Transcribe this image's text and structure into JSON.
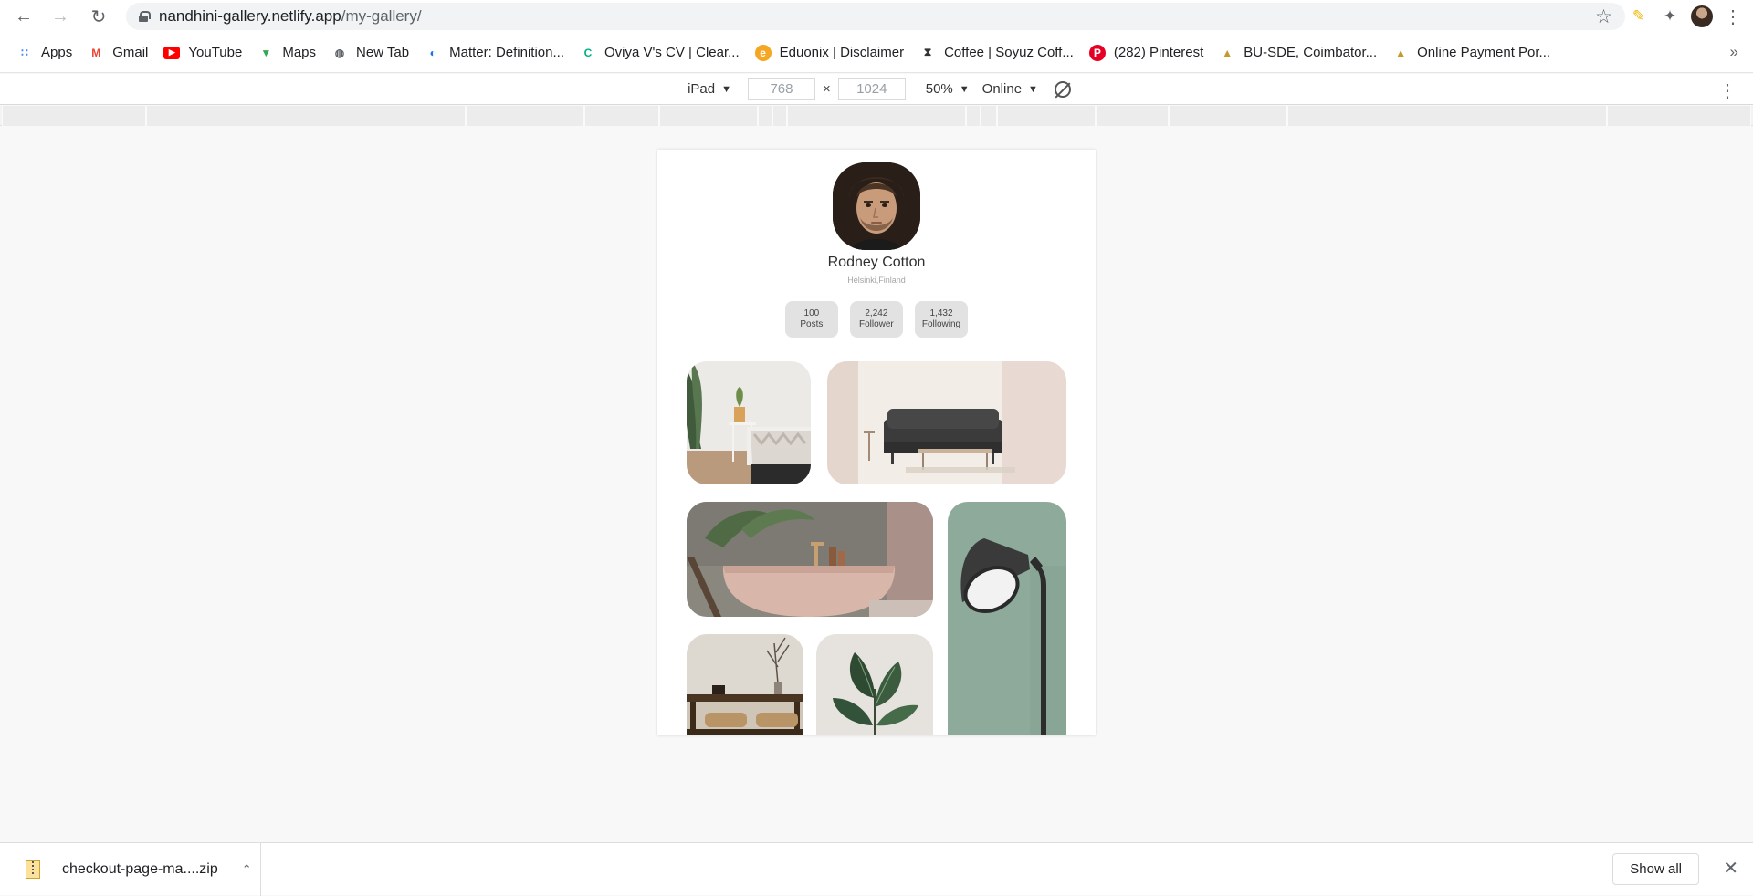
{
  "browser": {
    "url_host": "nandhini-gallery.netlify.app",
    "url_path": "/my-gallery/",
    "bookmarks": [
      {
        "label": "Apps",
        "icon": "apps-grid-icon",
        "color": "#4285f4"
      },
      {
        "label": "Gmail",
        "icon": "gmail-icon",
        "color": "#ea4335"
      },
      {
        "label": "YouTube",
        "icon": "youtube-icon",
        "color": "#ff0000"
      },
      {
        "label": "Maps",
        "icon": "maps-pin-icon",
        "color": "#34a853"
      },
      {
        "label": "New Tab",
        "icon": "globe-icon",
        "color": "#5f6368"
      },
      {
        "label": "Matter: Definition...",
        "icon": "matter-icon",
        "color": "#1a73e8"
      },
      {
        "label": "Oviya V's CV | Clear...",
        "icon": "cv-icon",
        "color": "#00b386"
      },
      {
        "label": "Eduonix | Disclaimer",
        "icon": "eduonix-icon",
        "color": "#f5a623"
      },
      {
        "label": "Coffee | Soyuz Coff...",
        "icon": "coffee-icon",
        "color": "#333333"
      },
      {
        "label": "(282) Pinterest",
        "icon": "pinterest-icon",
        "color": "#e60023"
      },
      {
        "label": "BU-SDE, Coimbator...",
        "icon": "person-icon",
        "color": "#c49a2c"
      },
      {
        "label": "Online Payment Por...",
        "icon": "person-icon",
        "color": "#c49a2c"
      }
    ]
  },
  "devtools": {
    "device": "iPad",
    "width": "768",
    "height": "1024",
    "zoom": "50%",
    "network": "Online"
  },
  "profile": {
    "name": "Rodney Cotton",
    "location": "Helsinki,Finland",
    "stats": [
      {
        "value": "100",
        "label": "Posts"
      },
      {
        "value": "2,242",
        "label": "Follower"
      },
      {
        "value": "1,432",
        "label": "Following"
      }
    ]
  },
  "download": {
    "filename": "checkout-page-ma....zip",
    "show_all": "Show all"
  }
}
